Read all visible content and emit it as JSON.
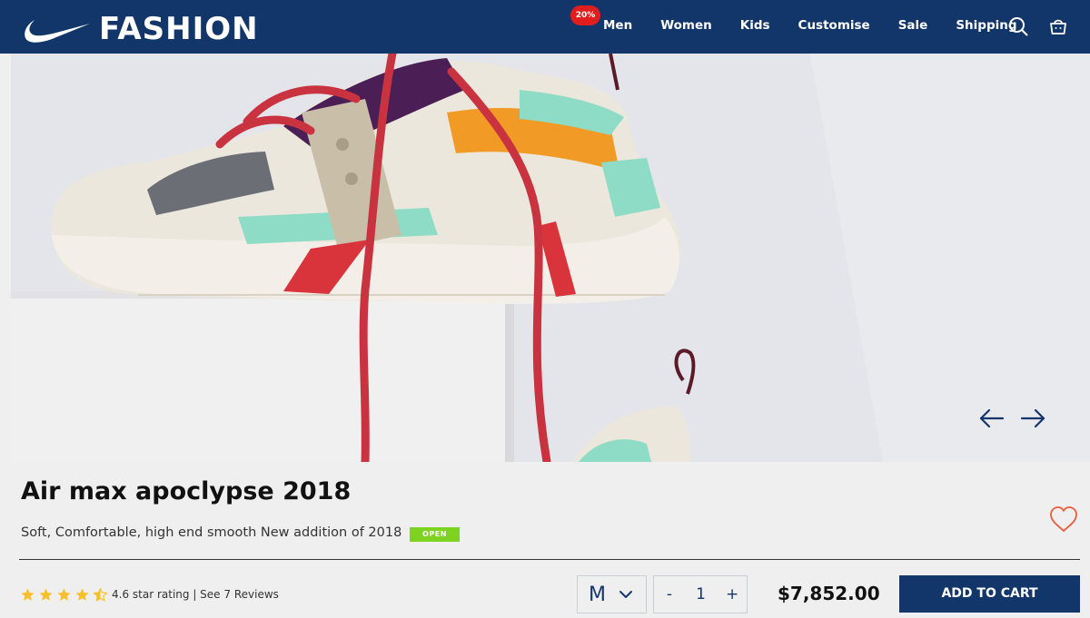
{
  "header": {
    "brand_name": "FASHION",
    "promo_badge": "20%",
    "nav": [
      "Men",
      "Women",
      "Kids",
      "Customise",
      "Sale",
      "Shipping"
    ],
    "icons": [
      "search-icon",
      "cart-icon"
    ]
  },
  "product": {
    "title": "Air max apoclypse 2018",
    "subtitle": "Soft, Comfortable, high end smooth New addition of 2018",
    "status_badge": "OPEN",
    "rating": 4.6,
    "rating_text": "4.6 star rating | See 7 Reviews",
    "size": "M",
    "quantity": "1",
    "qty_minus": "-",
    "qty_plus": "+",
    "price": "$7,852.00",
    "cart_label": "ADD TO CART"
  },
  "colors": {
    "brand": "#13366a",
    "badge_red": "#e11d1d",
    "open_green": "#7ed321",
    "star": "#f6c026",
    "heart": "#ea5a3c"
  }
}
